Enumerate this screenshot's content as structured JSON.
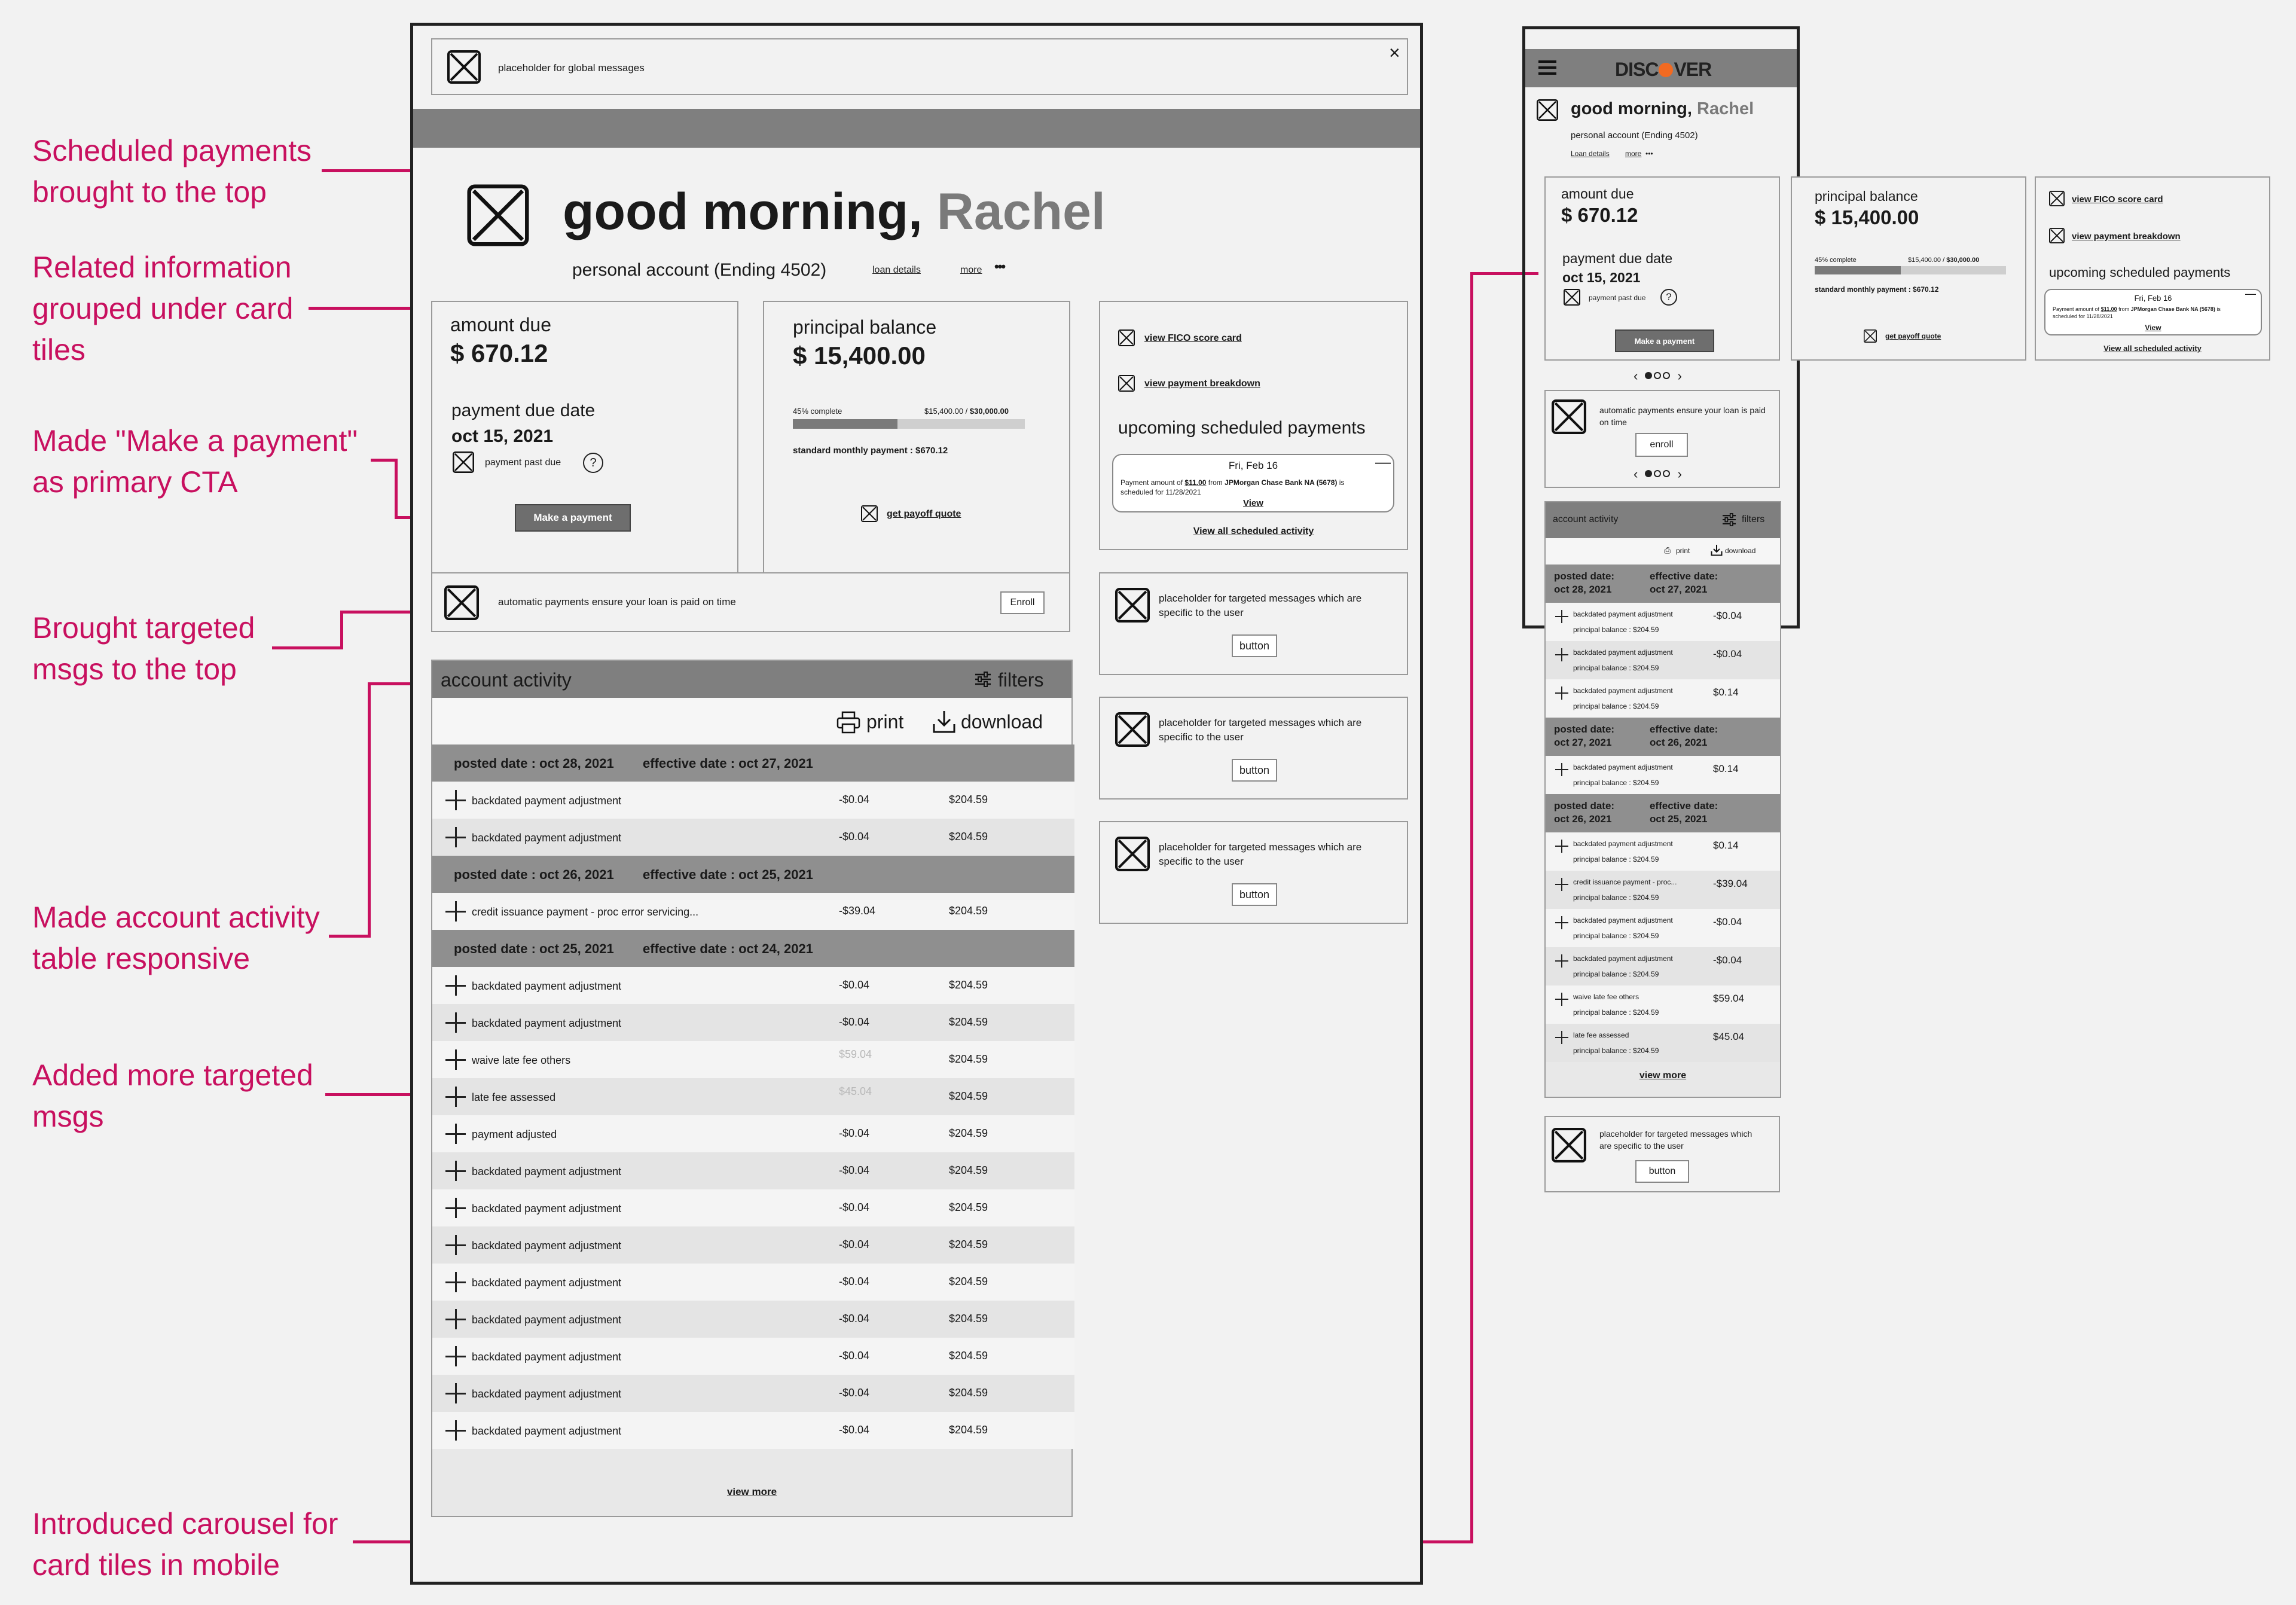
{
  "annotations": {
    "a1": [
      "Scheduled payments",
      "brought to the top"
    ],
    "a2": [
      "Related information",
      "grouped under card",
      "tiles"
    ],
    "a3": [
      "Made \"Make a payment\"",
      "as primary CTA"
    ],
    "a4": [
      "Brought targeted",
      "msgs to the top"
    ],
    "a5": [
      "Made account activity",
      "table responsive"
    ],
    "a6": [
      "Added more targeted",
      "msgs"
    ],
    "a7": [
      "Introduced carousel for",
      "card tiles in mobile"
    ]
  },
  "desktop": {
    "global_msg": "placeholder for global messages",
    "close": "×",
    "greeting": "good morning,",
    "name": "Rachel",
    "account": "personal account (Ending 4502)",
    "loan_details": "loan details",
    "more": "more",
    "dots": "•••",
    "amount_due_label": "amount due",
    "amount_due": "$ 670.12",
    "due_date_label": "payment due date",
    "due_date": "oct 15, 2021",
    "past_due": "payment past due",
    "help": "?",
    "make_payment": "Make a payment",
    "principal_label": "principal balance",
    "principal": "$ 15,400.00",
    "pct": "45% complete",
    "progress_of": "$15,400.00 /",
    "progress_total": "$30,000.00",
    "progress_fraction": 0.45,
    "std_payment": "standard monthly payment : $670.12",
    "payoff": "get payoff quote",
    "fico": "view FICO score card",
    "breakdown": "view payment breakdown",
    "upcoming": "upcoming scheduled payments",
    "sched_date": "Fri, Feb 16",
    "sched_text_a": "Payment amount of",
    "sched_amt": "$11.00",
    "sched_text_b": "from",
    "sched_bank": "JPMorgan Chase Bank NA (5678)",
    "sched_text_c": "is",
    "sched_text_d": "scheduled for 11/28/2021",
    "sched_view": "View",
    "view_all": "View all scheduled activity",
    "autopay": "automatic payments ensure your loan is paid on time",
    "enroll": "Enroll",
    "targeted": "placeholder for targeted messages which are specific to the user",
    "button": "button",
    "activity_title": "account activity",
    "filters": "filters",
    "print": "print",
    "download": "download",
    "view_more": "view more",
    "rows": [
      {
        "t": "h",
        "a": "posted date : oct 28, 2021",
        "b": "effective date : oct 27, 2021"
      },
      {
        "t": "r",
        "d": "backdated payment adjustment",
        "amt": "-$0.04",
        "bal": "$204.59"
      },
      {
        "t": "r",
        "d": "backdated payment adjustment",
        "amt": "-$0.04",
        "bal": "$204.59"
      },
      {
        "t": "h",
        "a": "posted date : oct 26, 2021",
        "b": "effective date : oct 25, 2021"
      },
      {
        "t": "r",
        "d": "credit issuance payment - proc error servicing...",
        "amt": "-$39.04",
        "bal": "$204.59"
      },
      {
        "t": "h",
        "a": "posted date : oct 25, 2021",
        "b": "effective date : oct 24, 2021"
      },
      {
        "t": "r",
        "d": "backdated payment adjustment",
        "amt": "-$0.04",
        "bal": "$204.59"
      },
      {
        "t": "r",
        "d": "backdated payment adjustment",
        "amt": "-$0.04",
        "bal": "$204.59"
      },
      {
        "t": "r",
        "d": "waive late fee others",
        "amt": "$59.04",
        "bal": "$204.59",
        "faded": true
      },
      {
        "t": "r",
        "d": "late fee assessed",
        "amt": "$45.04",
        "bal": "$204.59",
        "faded": true
      },
      {
        "t": "r",
        "d": "payment adjusted",
        "amt": "-$0.04",
        "bal": "$204.59"
      },
      {
        "t": "r",
        "d": "backdated payment adjustment",
        "amt": "-$0.04",
        "bal": "$204.59"
      },
      {
        "t": "r",
        "d": "backdated payment adjustment",
        "amt": "-$0.04",
        "bal": "$204.59"
      },
      {
        "t": "r",
        "d": "backdated payment adjustment",
        "amt": "-$0.04",
        "bal": "$204.59"
      },
      {
        "t": "r",
        "d": "backdated payment adjustment",
        "amt": "-$0.04",
        "bal": "$204.59"
      },
      {
        "t": "r",
        "d": "backdated payment adjustment",
        "amt": "-$0.04",
        "bal": "$204.59"
      },
      {
        "t": "r",
        "d": "backdated payment adjustment",
        "amt": "-$0.04",
        "bal": "$204.59"
      },
      {
        "t": "r",
        "d": "backdated payment adjustment",
        "amt": "-$0.04",
        "bal": "$204.59"
      },
      {
        "t": "r",
        "d": "backdated payment adjustment",
        "amt": "-$0.04",
        "bal": "$204.59"
      }
    ]
  },
  "mobile": {
    "brand_a": "DISC",
    "brand_b": "VER",
    "brand_color": "#f26a21",
    "greeting": "good morning,",
    "name": "Rachel",
    "account": "personal account (Ending 4502)",
    "loan_details": "Loan details",
    "more": "more",
    "amount_due_label": "amount due",
    "amount_due": "$ 670.12",
    "due_date_label": "payment due date",
    "due_date": "oct 15, 2021",
    "past_due": "payment past due",
    "help": "?",
    "make_payment": "Make a payment",
    "principal_label": "principal balance",
    "principal": "$ 15,400.00",
    "pct": "45% complete",
    "progress_of": "$15,400.00 /",
    "progress_total": "$30,000.00",
    "progress_fraction": 0.45,
    "std_payment": "standard monthly payment : $670.12",
    "payoff": "get payoff quote",
    "fico": "view FICO score card",
    "breakdown": "view payment breakdown",
    "upcoming": "upcoming scheduled payments",
    "sched_date": "Fri, Feb 16",
    "sched_text_a": "Payment amount of",
    "sched_amt": "$11.00",
    "sched_text_b": "from",
    "sched_bank": "JPMorgan Chase Bank NA (5678)",
    "sched_text_c": "is",
    "sched_text_d": "scheduled for 11/28/2021",
    "sched_view": "View",
    "view_all": "View all scheduled activity",
    "carousel_prev": "‹",
    "carousel_next": "›",
    "autopay": "automatic payments ensure your loan is paid on time",
    "enroll": "enroll",
    "activity_title": "account activity",
    "filters": "filters",
    "print": "print",
    "download": "download",
    "view_more": "view more",
    "targeted": "placeholder for targeted messages which are specific to the user",
    "button": "button",
    "rows": [
      {
        "t": "h",
        "a": [
          "posted date:",
          "oct 28, 2021"
        ],
        "b": [
          "effective date:",
          "oct 27, 2021"
        ]
      },
      {
        "t": "r",
        "d": "backdated payment adjustment",
        "p": "principal balance : $204.59",
        "amt": "-$0.04"
      },
      {
        "t": "r",
        "d": "backdated payment adjustment",
        "p": "principal balance : $204.59",
        "amt": "-$0.04"
      },
      {
        "t": "r",
        "d": "backdated payment adjustment",
        "p": "principal balance : $204.59",
        "amt": "$0.14"
      },
      {
        "t": "h",
        "a": [
          "posted date:",
          "oct 27, 2021"
        ],
        "b": [
          "effective date:",
          "oct 26, 2021"
        ]
      },
      {
        "t": "r",
        "d": "backdated payment adjustment",
        "p": "principal balance : $204.59",
        "amt": "$0.14"
      },
      {
        "t": "h",
        "a": [
          "posted date:",
          "oct 26, 2021"
        ],
        "b": [
          "effective date:",
          "oct 25, 2021"
        ]
      },
      {
        "t": "r",
        "d": "backdated payment adjustment",
        "p": "principal balance : $204.59",
        "amt": "$0.14"
      },
      {
        "t": "r",
        "d": "credit issuance payment - proc...",
        "p": "principal balance : $204.59",
        "amt": "-$39.04"
      },
      {
        "t": "r",
        "d": "backdated payment adjustment",
        "p": "principal balance : $204.59",
        "amt": "-$0.04"
      },
      {
        "t": "r",
        "d": "backdated payment adjustment",
        "p": "principal balance : $204.59",
        "amt": "-$0.04"
      },
      {
        "t": "r",
        "d": "waive late fee others",
        "p": "principal balance : $204.59",
        "amt": "$59.04"
      },
      {
        "t": "r",
        "d": "late fee assessed",
        "p": "principal balance : $204.59",
        "amt": "$45.04"
      }
    ]
  }
}
